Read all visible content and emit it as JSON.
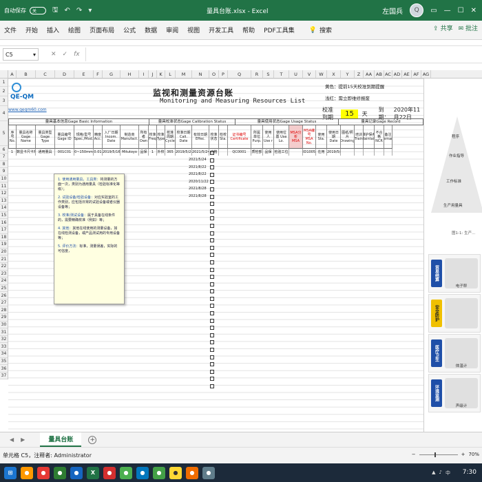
{
  "titlebar": {
    "autosave_label": "自动保存",
    "autosave_state": "关",
    "title": "量具台账.xlsx  -  Excel",
    "user": "左国兵",
    "avatar_text": "Q"
  },
  "ribbon": {
    "tabs": [
      "文件",
      "开始",
      "插入",
      "绘图",
      "页面布局",
      "公式",
      "数据",
      "审阅",
      "视图",
      "开发工具",
      "帮助",
      "PDF工具集"
    ],
    "search_label": "搜索",
    "share_label": "共享",
    "comment_label": "批注"
  },
  "formula_bar": {
    "name_box": "C5",
    "fx": "fx",
    "cancel": "✕",
    "enter": "✓",
    "value": ""
  },
  "columns": [
    "A",
    "B",
    "C",
    "D",
    "E",
    "F",
    "G",
    "H",
    "I",
    "J",
    "K",
    "L",
    "M",
    "N",
    "O",
    "P",
    "Q",
    "R",
    "S",
    "T",
    "U",
    "V",
    "W",
    "X",
    "Y",
    "Z",
    "AA",
    "AB",
    "AC",
    "AD",
    "AE",
    "AF",
    "AG"
  ],
  "rows": [
    "1",
    "2",
    "3",
    "4",
    "5",
    "6",
    "7",
    "8",
    "9",
    "10",
    "11",
    "12",
    "13",
    "14",
    "15",
    "16",
    "17",
    "18",
    "19",
    "20",
    "21",
    "22",
    "23",
    "24",
    "25",
    "26",
    "27",
    "28",
    "29",
    "30",
    "31",
    "32",
    "33",
    "34",
    "35",
    "36",
    "37"
  ],
  "sheet": {
    "logo_text": "QE-QM",
    "link": "www.qeqm60.com",
    "title_cn": "监视和测量资源台账",
    "title_en": "Monitoring and Measuring Resources List",
    "note1": "黄色：提前15天校准到期提醒",
    "note2": "浅红：需立即维修报废",
    "calib_label": "校准到期",
    "calib_days": "15",
    "calib_unit": "天",
    "today_label": "到期：",
    "today_date": "2020年11月22日",
    "sections": [
      "量具基本信息Gage Basic Information",
      "量具校准状态Gage Calibration Status",
      "量具使用状态Gage Usage Status",
      "量具记录Gage Record"
    ],
    "headers": [
      "序号 No.",
      "量具名称 Gage Name",
      "量具类型 Gage Type",
      "量具编号 Gage ID",
      "规格/型号 Spec./Mod.",
      "精度 Acc.",
      "入厂日期 Incom. Date",
      "制造商 Manufact.",
      "所有者 Own",
      "校准 Freq",
      "校准 Type",
      "校准周期 Cycle",
      "校准日期 Cali. Date",
      "有效日期 Effec.",
      "校准 状态",
      "检校 Sta.",
      "证书编号 Certificate",
      "所属单位 Purp.",
      "使用人 Use r",
      "使用位置 Use Lo.",
      "MSA分析 MSA",
      "MSA编号 MSA No.",
      "使用 Sta.",
      "使用日期 Date",
      "图纸/照片 Drawing",
      "培训 Train",
      "维护保养 Maintain",
      "不合格 NCR",
      "备注 Remark"
    ],
    "row6": [
      "1",
      "数显卡尺卡规",
      "通用量具",
      "001C01",
      "0~150mm",
      "0.01",
      "2019/5/16",
      "Mitutoyo",
      "品保",
      "1",
      "外校",
      "365",
      "2019/5/24",
      "2021/5/24",
      "合格",
      "",
      "QC0001",
      "质检部",
      "品保",
      "检验工位",
      "",
      "ID1005001",
      "在用",
      "2019/5/3",
      "",
      "",
      "",
      "",
      ""
    ],
    "dates": [
      "2021/5/24",
      "2021/8/22",
      "2021/8/22",
      "2020/11/22",
      "2021/8/28",
      "2021/8/28"
    ],
    "comment": {
      "p1_head": "1. 使用通用量具，工具类：",
      "p1": "将测量的方面一次，类别为通用量具（检验标准化等级）；",
      "p2_head": "2. 试验设备/检验设备：",
      "p2": "对应实验室的工作类别，应包括日常的试验设备或者仪器设备等；",
      "p3_head": "3. 校准/测试设备：",
      "p3": "属于具备在线条件的，需要精确校准（例如）等；",
      "p4_head": "4. 其他：",
      "p4": "其他在线使用的测量设备，如在线检测设备，或产品测试用的专用设备等；",
      "p5_head": "5. 评价方法：",
      "p5": "标准，测量误差，实际的可信度，"
    }
  },
  "side_panel": {
    "pyramid_labels": [
      "程序",
      "作业指导",
      "工作标准",
      "生产用量具"
    ],
    "caption": "图1-1: 生产...",
    "cards": [
      {
        "tag": "贸易结算",
        "label": "电子秤",
        "color": "#1f4fa8"
      },
      {
        "tag": "安全防护",
        "label": "",
        "color": "#f0c000"
      },
      {
        "tag": "医疗卫生",
        "label": "体温计",
        "color": "#1f4fa8"
      },
      {
        "tag": "环境监测",
        "label": "声级计",
        "color": "#1f4fa8"
      }
    ]
  },
  "sheet_tabs": {
    "active": "量具台账",
    "add": "+"
  },
  "status": {
    "left": "单元格 C5，注释者: Administrator",
    "zoom": "70%"
  },
  "taskbar": {
    "time": "7:30",
    "lang": "中"
  }
}
